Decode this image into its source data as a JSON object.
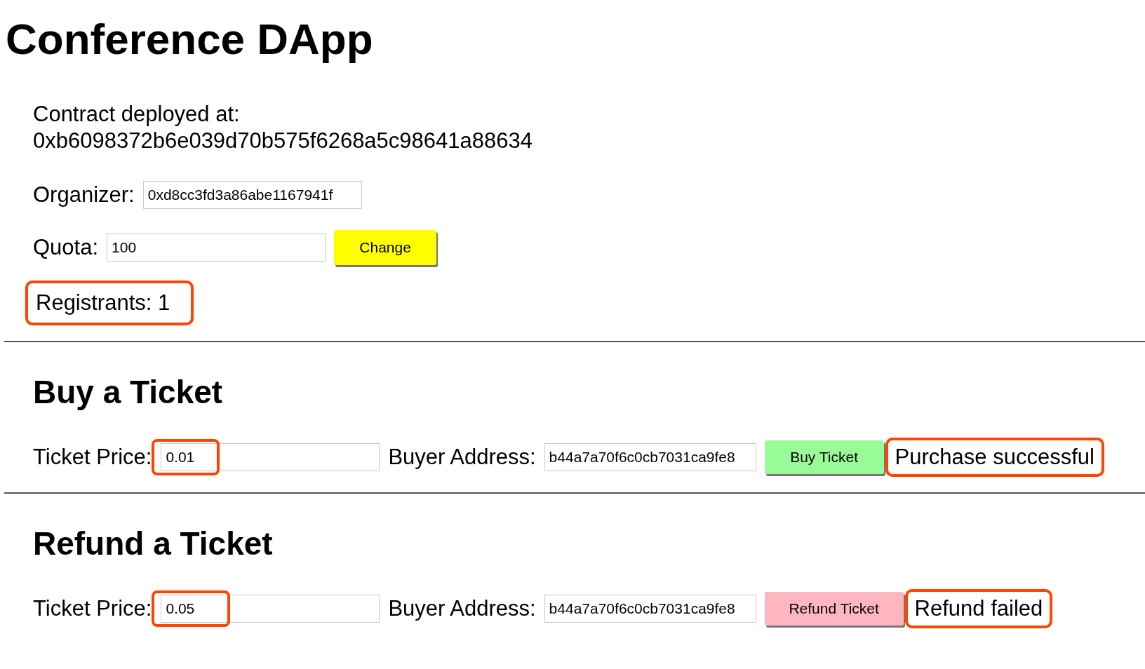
{
  "title": "Conference DApp",
  "contract": {
    "label": "Contract deployed at:",
    "address": "0xb6098372b6e039d70b575f6268a5c98641a88634"
  },
  "organizer": {
    "label": "Organizer:",
    "value": "0xd8cc3fd3a86abe1167941f"
  },
  "quota": {
    "label": "Quota:",
    "value": "100",
    "button": "Change"
  },
  "registrants": {
    "text": "Registrants: 1",
    "highlighted": true
  },
  "sections": [
    {
      "kind": "buy",
      "heading": "Buy a Ticket",
      "price_label": "Ticket Price:",
      "price_value": "0.01",
      "price_highlighted": true,
      "buyer_label": "Buyer Address:",
      "buyer_value": "b44a7a70f6c0cb7031ca9fe8",
      "button": "Buy Ticket",
      "status": "Purchase successful",
      "status_highlighted": true
    },
    {
      "kind": "refund",
      "heading": "Refund a Ticket",
      "price_label": "Ticket Price:",
      "price_value": "0.05",
      "price_highlighted": true,
      "buyer_label": "Buyer Address:",
      "buyer_value": "b44a7a70f6c0cb7031ca9fe8",
      "button": "Refund Ticket",
      "status": "Refund failed",
      "status_highlighted": true
    }
  ]
}
